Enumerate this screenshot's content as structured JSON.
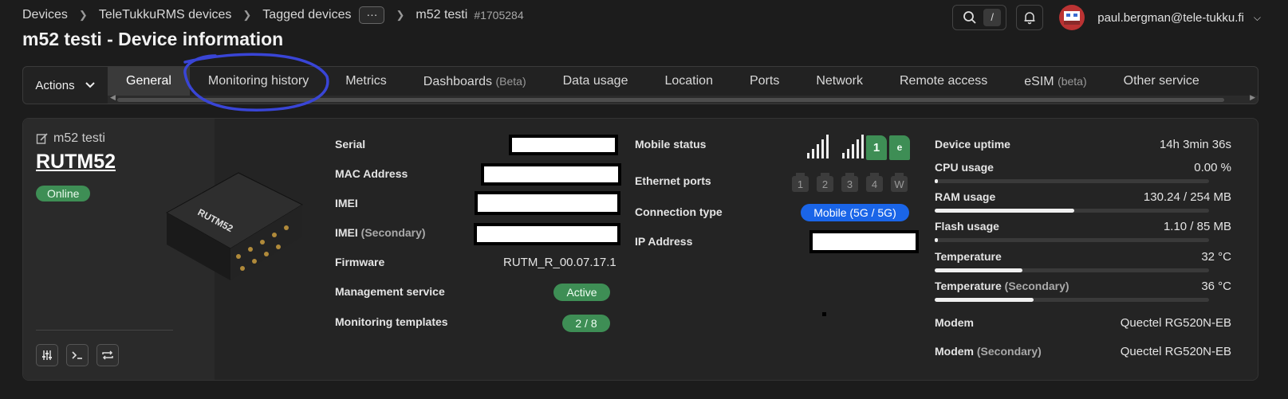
{
  "breadcrumb": {
    "items": [
      "Devices",
      "TeleTukkuRMS devices",
      "Tagged devices"
    ],
    "more": "···",
    "current": "m52 testi",
    "id": "#1705284"
  },
  "header": {
    "title": "m52 testi - Device information",
    "search_shortcut": "/",
    "user_email": "paul.bergman@tele-tukku.fi"
  },
  "tabbar": {
    "actions_label": "Actions",
    "tabs": [
      {
        "label": "General",
        "suffix": ""
      },
      {
        "label": "Monitoring history",
        "suffix": ""
      },
      {
        "label": "Metrics",
        "suffix": ""
      },
      {
        "label": "Dashboards",
        "suffix": "(Beta)"
      },
      {
        "label": "Data usage",
        "suffix": ""
      },
      {
        "label": "Location",
        "suffix": ""
      },
      {
        "label": "Ports",
        "suffix": ""
      },
      {
        "label": "Network",
        "suffix": ""
      },
      {
        "label": "Remote access",
        "suffix": ""
      },
      {
        "label": "eSIM",
        "suffix": "(beta)"
      },
      {
        "label": "Other service",
        "suffix": ""
      }
    ]
  },
  "device": {
    "alias": "m52 testi",
    "model": "RUTM52",
    "status": "Online",
    "image_text": "RUTM52"
  },
  "info_col1": {
    "serial_label": "Serial",
    "mac_label": "MAC Address",
    "imei_label": "IMEI",
    "imei2_label": "IMEI",
    "imei2_suffix": "(Secondary)",
    "firmware_label": "Firmware",
    "firmware_value": "RUTM_R_00.07.17.1",
    "mgmt_label": "Management service",
    "mgmt_value": "Active",
    "templates_label": "Monitoring templates",
    "templates_value": "2 / 8"
  },
  "info_col2": {
    "mobile_label": "Mobile status",
    "sim1": "1",
    "sim2": "e",
    "ethernet_label": "Ethernet ports",
    "ports": [
      "1",
      "2",
      "3",
      "4",
      "W"
    ],
    "conn_label": "Connection type",
    "conn_value": "Mobile (5G / 5G)",
    "ip_label": "IP Address"
  },
  "info_col3": {
    "uptime_label": "Device uptime",
    "uptime_value": "14h 3min 36s",
    "cpu_label": "CPU usage",
    "cpu_value": "0.00 %",
    "ram_label": "RAM usage",
    "ram_value": "130.24 / 254 MB",
    "flash_label": "Flash usage",
    "flash_value": "1.10 / 85 MB",
    "temp_label": "Temperature",
    "temp_value": "32 °C",
    "temp2_label": "Temperature",
    "temp2_suffix": "(Secondary)",
    "temp2_value": "36 °C",
    "modem_label": "Modem",
    "modem_value": "Quectel RG520N-EB",
    "modem2_label": "Modem",
    "modem2_suffix": "(Secondary)",
    "modem2_value": "Quectel RG520N-EB"
  },
  "usage_levels": {
    "cpu": 0.0,
    "ram": 0.51,
    "flash": 0.013,
    "temp": 0.32,
    "temp2": 0.36
  }
}
